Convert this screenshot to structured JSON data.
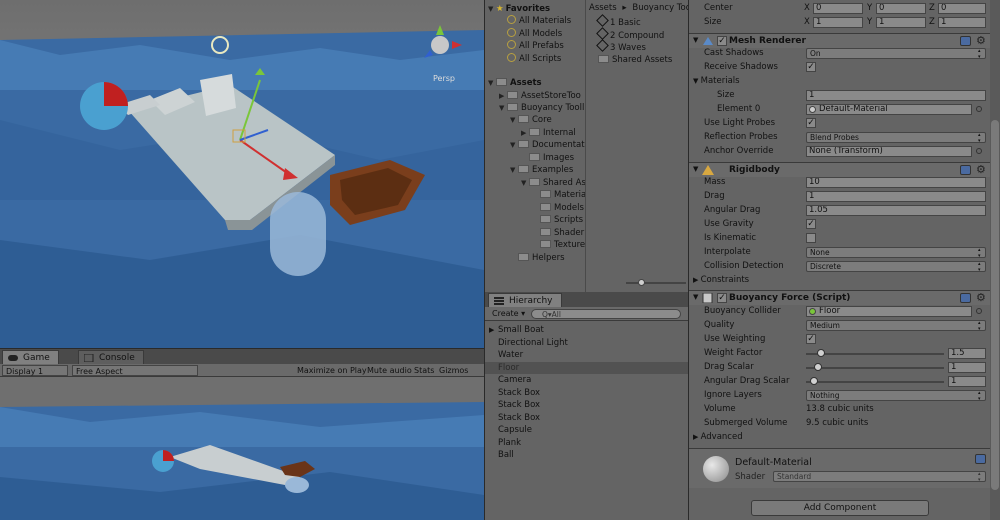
{
  "scene": {
    "persp_label": "Persp"
  },
  "game_tabs": {
    "game": "Game",
    "console": "Console"
  },
  "game_toolbar": {
    "display": "Display 1",
    "aspect": "Free Aspect",
    "maximize": "Maximize on Play",
    "mute": "Mute audio",
    "stats": "Stats",
    "gizmos": "Gizmos"
  },
  "project": {
    "favorites": "Favorites",
    "fav_items": [
      "All Materials",
      "All Models",
      "All Prefabs",
      "All Scripts"
    ],
    "assets": "Assets",
    "tree": [
      "AssetStoreToo",
      "Buoyancy Tooll",
      "Core",
      "Internal",
      "Documentat",
      "Images",
      "Examples",
      "Shared As",
      "Materia",
      "Models",
      "Scripts",
      "Shader",
      "Texture",
      "Helpers"
    ],
    "breadcrumb": [
      "Assets",
      "Buoyancy Too"
    ],
    "files": [
      "1 Basic",
      "2 Compound",
      "3 Waves",
      "Shared Assets"
    ]
  },
  "hierarchy": {
    "tab": "Hierarchy",
    "create": "Create",
    "search_placeholder": "Q▾All",
    "items": [
      "Small Boat",
      "Directional Light",
      "Water",
      "Floor",
      "Camera",
      "Stack Box",
      "Stack Box",
      "Stack Box",
      "Capsule",
      "Plank",
      "Ball"
    ],
    "selected": "Floor"
  },
  "inspector": {
    "transform": {
      "center_label": "Center",
      "size_label": "Size",
      "center": {
        "x": "0",
        "y": "0",
        "z": "0"
      },
      "size": {
        "x": "1",
        "y": "1",
        "z": "1"
      }
    },
    "mesh_renderer": {
      "title": "Mesh Renderer",
      "cast_shadows_label": "Cast Shadows",
      "cast_shadows": "On",
      "receive_shadows_label": "Receive Shadows",
      "materials_label": "Materials",
      "size_label": "Size",
      "size": "1",
      "element0_label": "Element 0",
      "element0": "Default-Material",
      "light_probes_label": "Use Light Probes",
      "reflection_label": "Reflection Probes",
      "reflection": "Blend Probes",
      "anchor_label": "Anchor Override",
      "anchor": "None (Transform)"
    },
    "rigidbody": {
      "title": "Rigidbody",
      "mass_label": "Mass",
      "mass": "10",
      "drag_label": "Drag",
      "drag": "1",
      "angular_drag_label": "Angular Drag",
      "angular_drag": "1.05",
      "gravity_label": "Use Gravity",
      "kinematic_label": "Is Kinematic",
      "interpolate_label": "Interpolate",
      "interpolate": "None",
      "collision_label": "Collision Detection",
      "collision": "Discrete",
      "constraints_label": "Constraints"
    },
    "buoyancy": {
      "title": "Buoyancy Force (Script)",
      "collider_label": "Buoyancy Collider",
      "collider": "Floor",
      "quality_label": "Quality",
      "quality": "Medium",
      "weighting_label": "Use Weighting",
      "weight_factor_label": "Weight Factor",
      "weight_factor": "1.5",
      "weight_factor_slider": 0.08,
      "drag_scalar_label": "Drag Scalar",
      "drag_scalar": "1",
      "drag_scalar_slider": 0.06,
      "angular_scalar_label": "Angular Drag Scalar",
      "angular_scalar": "1",
      "angular_scalar_slider": 0.03,
      "ignore_label": "Ignore Layers",
      "ignore": "Nothing",
      "volume_label": "Volume",
      "volume": "13.8 cubic units",
      "submerged_label": "Submerged Volume",
      "submerged": "9.5 cubic units",
      "advanced_label": "Advanced"
    },
    "material": {
      "name": "Default-Material",
      "shader_label": "Shader",
      "shader": "Standard"
    },
    "add_component": "Add Component"
  },
  "colors": {
    "water": "#3a6fa8",
    "floor": "#b9c4c6",
    "boat": "#7a3e1c",
    "ball_red": "#c02020",
    "ball_blue": "#4aa0d0"
  }
}
